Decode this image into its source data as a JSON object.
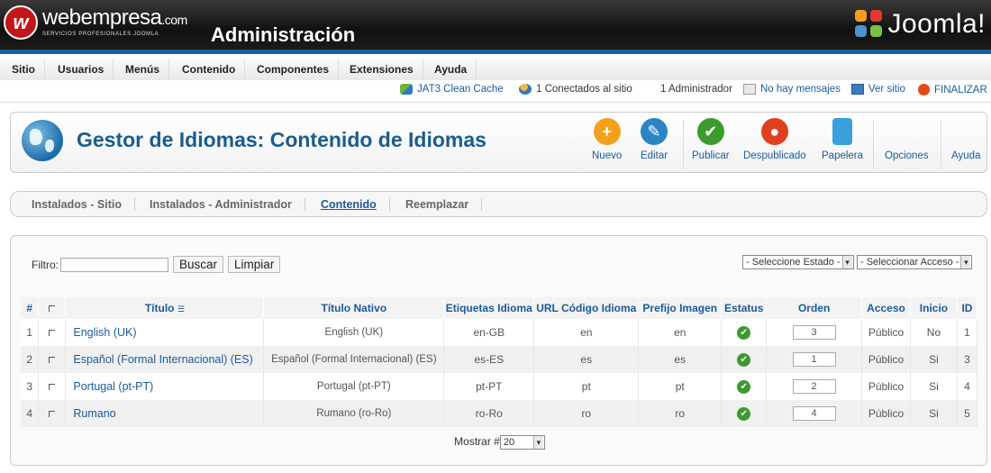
{
  "brand": {
    "name": "webempresa",
    "tld": ".com",
    "tagline": "SERVICIOS PROFESIONALES JOOMLA",
    "admin_title": "Administración",
    "cms": "Joomla!"
  },
  "menu": [
    "Sitio",
    "Usuarios",
    "Menús",
    "Contenido",
    "Componentes",
    "Extensiones",
    "Ayuda"
  ],
  "status": {
    "cache": "JAT3 Clean Cache",
    "connected": "1 Conectados al sitio",
    "admins": "1 Administrador",
    "messages": "No hay mensajes",
    "view_site": "Ver sitio",
    "logout": "FINALIZAR"
  },
  "page_title": "Gestor de Idiomas: Contenido de Idiomas",
  "toolbar": {
    "new": "Nuevo",
    "edit": "Editar",
    "publish": "Publicar",
    "unpublish": "Despublicado",
    "trash": "Papelera",
    "options": "Opciones",
    "help": "Ayuda"
  },
  "tabs": [
    "Instalados - Sitio",
    "Instalados - Administrador",
    "Contenido",
    "Reemplazar"
  ],
  "active_tab": "Contenido",
  "filter": {
    "label": "Filtro:",
    "value": "",
    "search": "Buscar",
    "clear": "Limpiar"
  },
  "selects": {
    "state": "- Seleccione Estado -",
    "access": "- Seleccionar Acceso -"
  },
  "table": {
    "headers": [
      "#",
      "",
      "Título",
      "Título Nativo",
      "Etiquetas Idioma",
      "URL Código Idioma",
      "Prefijo Imagen",
      "Estatus",
      "Orden",
      "Acceso",
      "Inicio",
      "ID"
    ],
    "rows": [
      {
        "num": "1",
        "title": "English (UK)",
        "native": "English (UK)",
        "tag": "en-GB",
        "url": "en",
        "prefix": "en",
        "order": "3",
        "access": "Público",
        "home": "No",
        "id": "1"
      },
      {
        "num": "2",
        "title": "Español (Formal Internacional) (ES)",
        "native": "Español (Formal Internacional) (ES)",
        "tag": "es-ES",
        "url": "es",
        "prefix": "es",
        "order": "1",
        "access": "Público",
        "home": "Si",
        "id": "3"
      },
      {
        "num": "3",
        "title": "Portugal (pt-PT)",
        "native": "Portugal (pt-PT)",
        "tag": "pt-PT",
        "url": "pt",
        "prefix": "pt",
        "order": "2",
        "access": "Público",
        "home": "Si",
        "id": "4"
      },
      {
        "num": "4",
        "title": "Rumano",
        "native": "Rumano (ro-Ro)",
        "tag": "ro-Ro",
        "url": "ro",
        "prefix": "ro",
        "order": "4",
        "access": "Público",
        "home": "Si",
        "id": "5"
      }
    ]
  },
  "footer": {
    "show_label": "Mostrar #",
    "show_value": "20"
  },
  "colors": {
    "header_bar": "#1e5f93",
    "link": "#1b5a9a",
    "title": "#1a5d8c",
    "logo_red": "#c0161c"
  }
}
